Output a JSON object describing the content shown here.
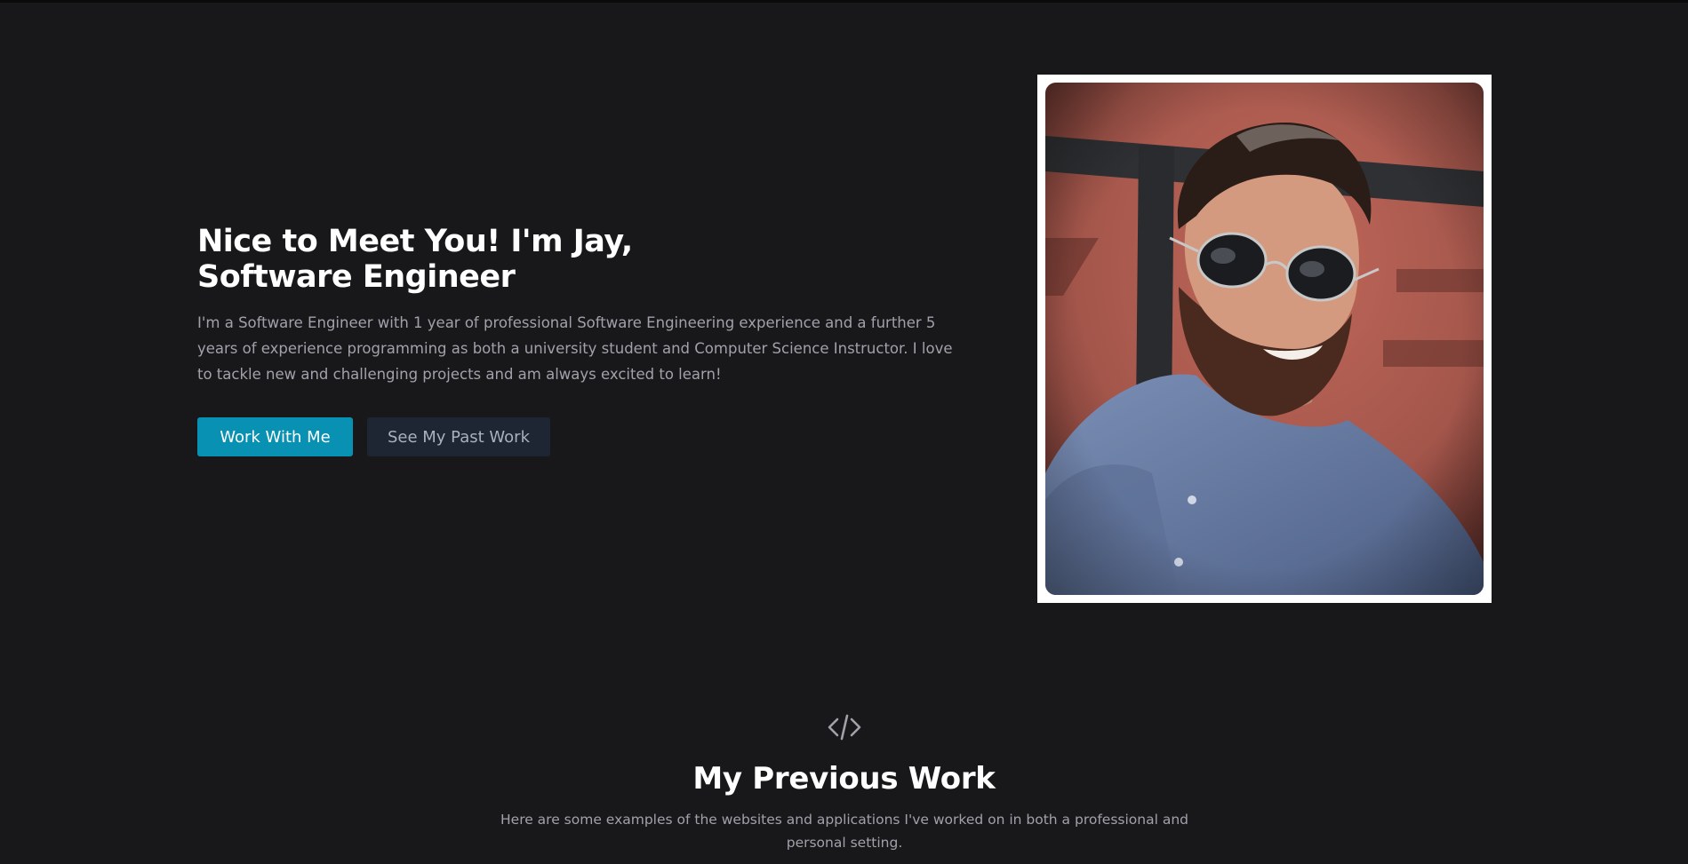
{
  "hero": {
    "title_line1": "Nice to Meet You! I'm Jay,",
    "title_line2": "Software Engineer",
    "description": "I'm a Software Engineer with 1 year of professional Software Engineering experience and a further 5 years of experience programming as both a university student and Computer Science Instructor. I love to tackle new and challenging projects and am always excited to learn!",
    "primary_button": "Work With Me",
    "secondary_button": "See My Past Work"
  },
  "portrait": {
    "icon": "profile-photo"
  },
  "work_section": {
    "icon": "code-icon",
    "title": "My Previous Work",
    "description": "Here are some examples of the websites and applications I've worked on in both a professional and personal setting."
  },
  "colors": {
    "background": "#18181b",
    "accent": "#0891b2",
    "secondary_button_bg": "#1e2533",
    "muted_text": "#a1a1aa"
  }
}
